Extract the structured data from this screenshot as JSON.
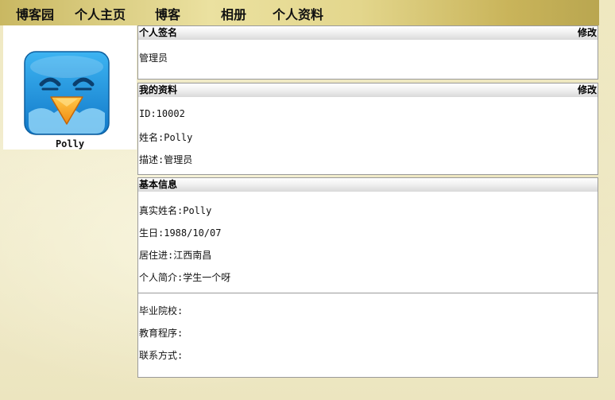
{
  "nav": {
    "items": [
      "博客园",
      "个人主页",
      "博客",
      "相册",
      "个人资料"
    ]
  },
  "sidebar": {
    "username": "Polly",
    "avatar_icon": "blue-bird-icon"
  },
  "signature": {
    "title": "个人签名",
    "edit_label": "修改",
    "text": "管理员"
  },
  "profile": {
    "title": "我的资料",
    "edit_label": "修改",
    "fields": [
      "ID:10002",
      "姓名:Polly",
      "描述:管理员"
    ]
  },
  "basic": {
    "title": "基本信息",
    "fields": [
      "真实姓名:Polly",
      "生日:1988/10/07",
      "居住进:江西南昌",
      "个人简介:学生一个呀"
    ]
  },
  "extra": {
    "fields": [
      "毕业院校:",
      "教育程序:",
      "联系方式:"
    ]
  },
  "colors": {
    "accent": "#c9b862",
    "avatar_blue": "#2a9be0",
    "beak": "#f6a623"
  }
}
